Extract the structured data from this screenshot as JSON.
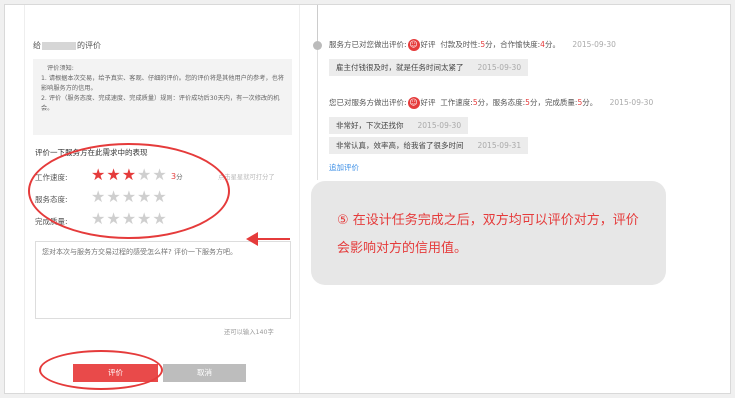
{
  "left_panel": {
    "eval_title_prefix": "给",
    "eval_title_suffix": "的评价",
    "notice": {
      "head": "评价须知:",
      "lines": [
        "1. 请根据本次交易，给予真实、客观、仔细的评价。您的评价将是其他用户的参考，也将影响服务方的信用。",
        "2. 评价（服务态度、完成速度、完成质量）规则：评价成功后30天内，有一次修改的机会。"
      ]
    },
    "performance_title": "评价一下服务方在此需求中的表现",
    "ratings": [
      {
        "label": "工作速度:",
        "stars": 3
      },
      {
        "label": "服务态度:",
        "stars": 0
      },
      {
        "label": "完成质量:",
        "stars": 0
      }
    ],
    "score_value": "3",
    "score_unit": "分",
    "star_hint": "点击星星就可打分了",
    "comment_placeholder": "您对本次与服务方交易过程的感受怎么样? 评价一下服务方吧。",
    "count_hint": "还可以输入140字",
    "submit_label": "评价",
    "cancel_label": "取消"
  },
  "right_panel": {
    "entry1": {
      "prefix": "服务方已对您做出评价:",
      "rating_word": "好评",
      "pay_label": "付款及时性:",
      "pay_score": "5",
      "coop_label": "合作愉快度:",
      "coop_score": "4",
      "unit": "分",
      "date": "2015-09-30",
      "comment": "雇主付钱很及时，就是任务时间太紧了",
      "comment_date": "2015-09-30"
    },
    "entry2": {
      "prefix": "您已对服务方做出评价:",
      "rating_word": "好评",
      "speed_label": "工作速度:",
      "speed_score": "5",
      "attitude_label": "服务态度:",
      "attitude_score": "5",
      "quality_label": "完成质量:",
      "quality_score": "5",
      "unit": "分",
      "date": "2015-09-30",
      "comment1": "非常好，下次还找你",
      "comment1_date": "2015-09-30",
      "comment2": "非常认真，效率高，给我省了很多时间",
      "comment2_date": "2015-09-31"
    },
    "add_review": "追加评价",
    "note": "⑤ 在设计任务完成之后，双方均可以评价对方，评价会影响对方的信用值。"
  },
  "colors": {
    "accent": "#e53b3b",
    "link": "#3a8ee6",
    "cancel": "#bdbdbd"
  },
  "icons": [
    "smile-face-icon",
    "star-icon",
    "arrow-left-icon"
  ]
}
